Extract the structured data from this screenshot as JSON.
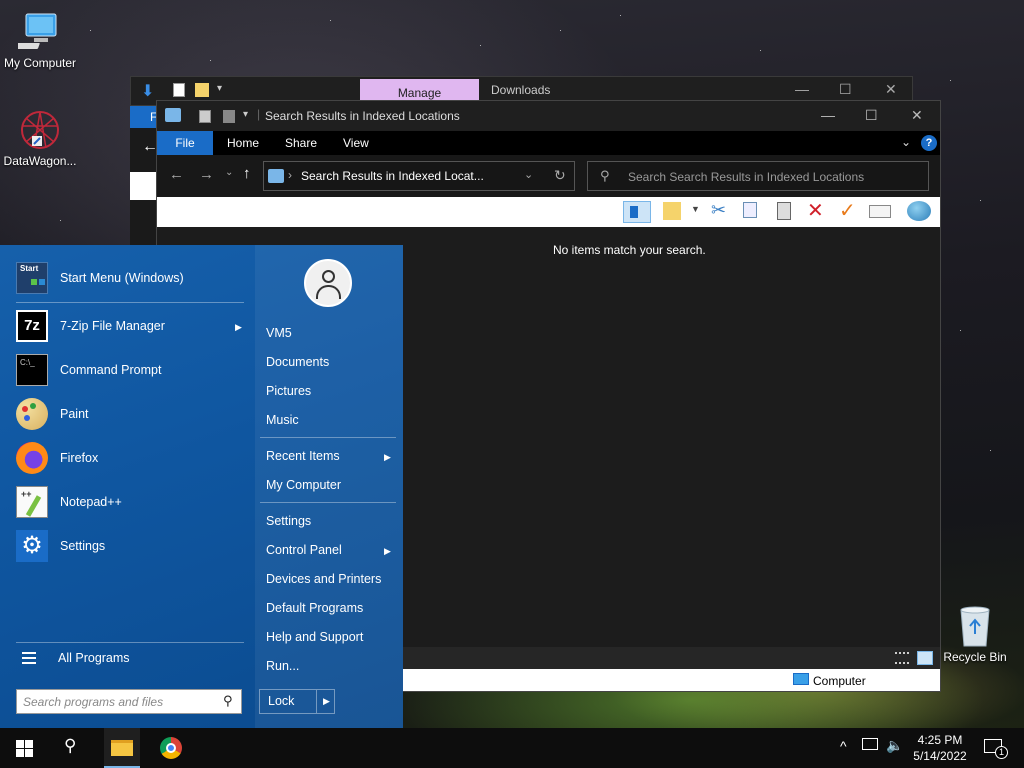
{
  "desktop": {
    "icons": [
      {
        "label": "My Computer"
      },
      {
        "label": "DataWagon..."
      },
      {
        "label": "Recycle Bin"
      }
    ]
  },
  "back_window": {
    "manage_tab": "Manage",
    "title": "Downloads",
    "file_tab_initial": "F"
  },
  "explorer": {
    "title": "Search Results in Indexed Locations",
    "ribbon_tabs": [
      "File",
      "Home",
      "Share",
      "View"
    ],
    "address": "Search Results in Indexed Locat...",
    "search_placeholder": "Search Search Results in Indexed Locations",
    "empty_message": "No items match your search.",
    "status_location": "Computer",
    "accent": "#1a6cc7"
  },
  "start_menu": {
    "pinned": [
      {
        "label": "Start Menu (Windows)",
        "icon": "start-menu-icon"
      },
      {
        "label": "7-Zip File Manager",
        "icon": "7zip-icon",
        "submenu": true
      },
      {
        "label": "Command Prompt",
        "icon": "cmd-icon"
      },
      {
        "label": "Paint",
        "icon": "paint-icon"
      },
      {
        "label": "Firefox",
        "icon": "firefox-icon"
      },
      {
        "label": "Notepad++",
        "icon": "notepadpp-icon"
      },
      {
        "label": "Settings",
        "icon": "settings-gear-icon"
      }
    ],
    "all_programs": "All Programs",
    "search_placeholder": "Search programs and files",
    "right_items": {
      "user": "VM5",
      "documents": "Documents",
      "pictures": "Pictures",
      "music": "Music",
      "recent": "Recent Items",
      "my_computer": "My Computer",
      "settings": "Settings",
      "control_panel": "Control Panel",
      "devices": "Devices and Printers",
      "default_programs": "Default Programs",
      "help": "Help and Support",
      "run": "Run..."
    },
    "lock": "Lock",
    "start_icon_text": "Start"
  },
  "taskbar": {
    "time": "4:25 PM",
    "date": "5/14/2022",
    "notification_count": "1"
  }
}
